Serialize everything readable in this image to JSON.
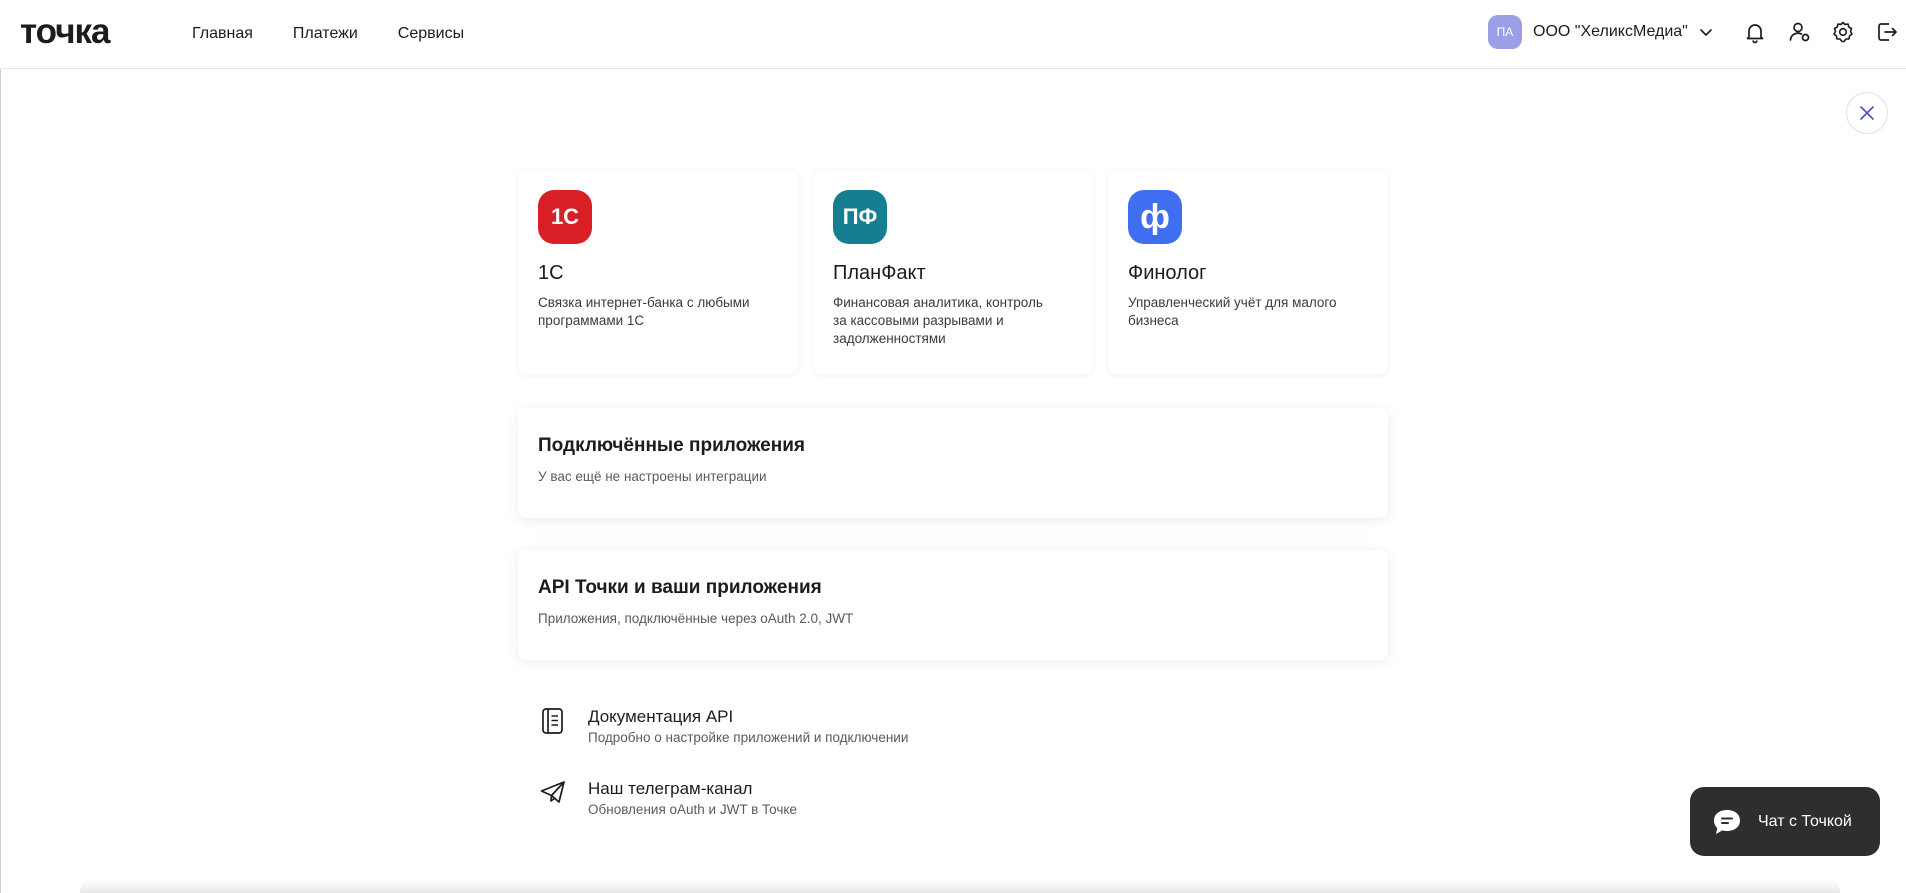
{
  "header": {
    "logo": "точка",
    "nav": [
      "Главная",
      "Платежи",
      "Сервисы"
    ],
    "account": {
      "initials": "ПА",
      "name": "ООО \"ХеликсМедиа\""
    },
    "icons": [
      "chevron-down-icon",
      "bell-icon",
      "user-link-icon",
      "gear-icon",
      "logout-icon"
    ]
  },
  "apps": [
    {
      "title": "1С",
      "description": "Связка интернет-банка с любыми программами 1С",
      "logo_text": "1С",
      "logo_color": "#d81f26"
    },
    {
      "title": "ПланФакт",
      "description": "Финансовая аналитика, контроль за кассовыми разрывами и задолженностями",
      "logo_text": "ПФ",
      "logo_color": "#157f91"
    },
    {
      "title": "Финолог",
      "description": "Управленческий учёт для малого бизнеса",
      "logo_text": "ф",
      "logo_color": "#3f6ff0"
    }
  ],
  "connected": {
    "title": "Подключённые приложения",
    "subtitle": "У вас ещё не настроены интеграции"
  },
  "api": {
    "title": "API Точки и ваши приложения",
    "subtitle": "Приложения, подключённые через oAuth 2.0, JWT"
  },
  "links": [
    {
      "title": "Документация API",
      "subtitle": "Подробно о настройке приложений и подключении",
      "icon": "document-icon"
    },
    {
      "title": "Наш телеграм-канал",
      "subtitle": "Обновления oAuth и JWT в Точке",
      "icon": "telegram-icon"
    }
  ],
  "chat": {
    "label": "Чат с Точкой"
  },
  "colors": {
    "avatar": "#9c9ee6",
    "close_icon": "#4a4fc4",
    "chat_bg": "#2e2e30"
  }
}
